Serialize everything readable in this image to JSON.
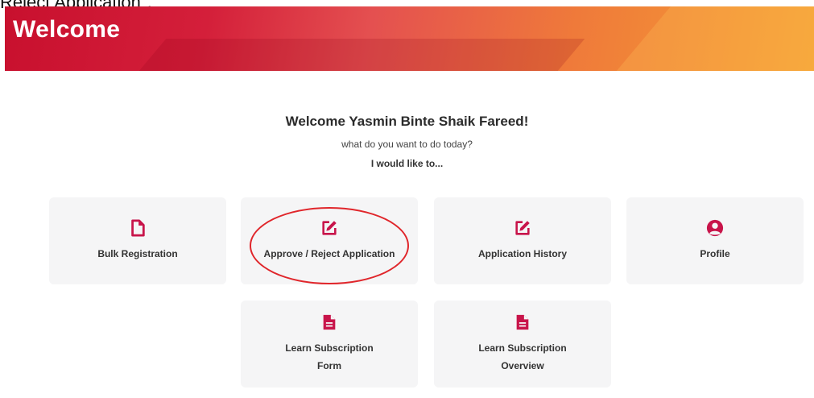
{
  "caption": "Reject Application\".",
  "banner": {
    "title": "Welcome"
  },
  "greeting": {
    "title": "Welcome Yasmin Binte Shaik Fareed!",
    "subtitle": "what do you want to do today?",
    "prompt": "I would like to..."
  },
  "cards": {
    "bulk": {
      "label": "Bulk Registration",
      "icon": "file-icon"
    },
    "approve": {
      "label": "Approve / Reject Application",
      "icon": "edit-icon"
    },
    "history": {
      "label": "Application History",
      "icon": "edit-icon"
    },
    "profile": {
      "label": "Profile",
      "icon": "user-circle-icon"
    },
    "lsform": {
      "label": "Learn Subscription Form",
      "icon": "file-text-icon"
    },
    "lsoverview": {
      "label": "Learn Subscription Overview",
      "icon": "file-text-icon"
    }
  },
  "colors": {
    "accent": "#c8144a",
    "banner_start": "#c8102e",
    "banner_end": "#f5a033",
    "card_bg": "#f5f5f6",
    "annotation": "#e0262b"
  }
}
